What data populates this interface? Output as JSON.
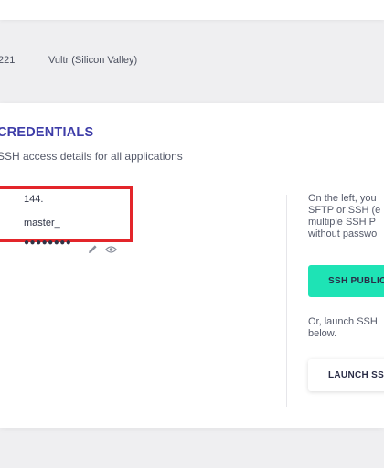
{
  "server": {
    "ip_suffix": "221",
    "provider": "Vultr (Silicon Valley)"
  },
  "card": {
    "title": "CREDENTIALS",
    "subtitle": "SSH access details for all applications"
  },
  "credentials": {
    "public_ip": "144.",
    "username": "master_",
    "password_masked": "●●●●●●●●",
    "edit_icon": "pencil-icon",
    "show_icon": "eye-icon",
    "highlight_color": "#e3252a"
  },
  "help": {
    "lines": [
      "On the left, you",
      "SFTP or SSH (e",
      "multiple SSH P",
      "without passwo"
    ],
    "ssh_key_button": "SSH PUBLIC",
    "launch_lines": [
      "Or, launch SSH",
      "below."
    ],
    "launch_button": "LAUNCH SS"
  },
  "colors": {
    "accent": "#3d3ca8",
    "primary_button": "#1ee3b5"
  }
}
